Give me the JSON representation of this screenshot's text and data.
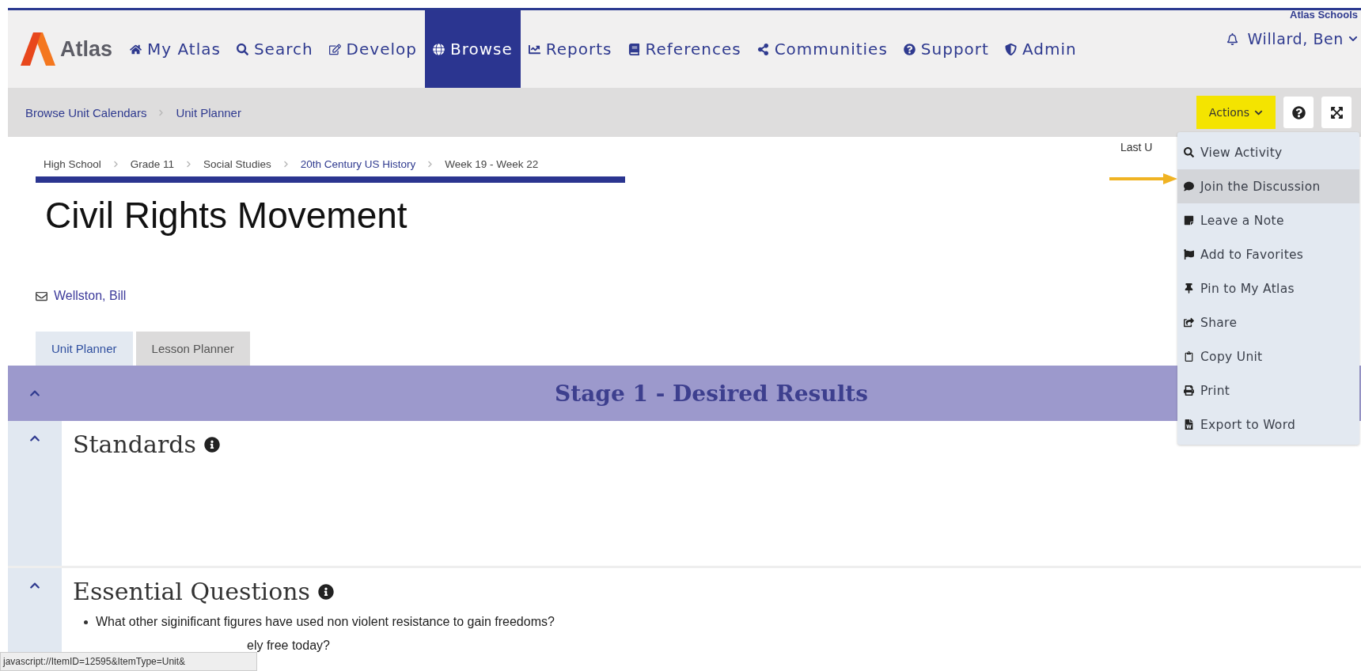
{
  "brand": {
    "name": "Atlas"
  },
  "nav": [
    {
      "label": "My Atlas",
      "selected": false
    },
    {
      "label": "Search",
      "selected": false
    },
    {
      "label": "Develop",
      "selected": false
    },
    {
      "label": "Browse",
      "selected": true
    },
    {
      "label": "Reports",
      "selected": false
    },
    {
      "label": "References",
      "selected": false
    },
    {
      "label": "Communities",
      "selected": false
    },
    {
      "label": "Support",
      "selected": false
    },
    {
      "label": "Admin",
      "selected": false
    }
  ],
  "account": {
    "school": "Atlas Schools",
    "user": "Willard, Ben"
  },
  "breadcrumb": [
    "Browse Unit Calendars",
    "Unit Planner"
  ],
  "actions": {
    "label": "Actions",
    "menu": [
      {
        "label": "View Activity",
        "highlighted": false
      },
      {
        "label": "Join the Discussion",
        "highlighted": true
      },
      {
        "label": "Leave a Note",
        "highlighted": false
      },
      {
        "label": "Add to Favorites",
        "highlighted": false
      },
      {
        "label": "Pin to My Atlas",
        "highlighted": false
      },
      {
        "label": "Share",
        "highlighted": false
      },
      {
        "label": "Copy Unit",
        "highlighted": false
      },
      {
        "label": "Print",
        "highlighted": false
      },
      {
        "label": "Export to Word",
        "highlighted": false
      }
    ]
  },
  "unit_path": [
    {
      "label": "High School",
      "link": false
    },
    {
      "label": "Grade 11",
      "link": false
    },
    {
      "label": "Social Studies",
      "link": false
    },
    {
      "label": "20th Century US History",
      "link": true
    },
    {
      "label": "Week 19 - Week 22",
      "link": false
    }
  ],
  "last_updated": "Last U",
  "title": "Civil Rights Movement",
  "author": "Wellston, Bill",
  "tabs": [
    {
      "label": "Unit Planner",
      "selected": true
    },
    {
      "label": "Lesson Planner",
      "selected": false
    }
  ],
  "stage": {
    "title": "Stage 1 - Desired Results",
    "expanded": true
  },
  "sections": [
    {
      "title": "Standards",
      "expanded": true
    },
    {
      "title": "Essential Questions",
      "expanded": true,
      "questions": [
        "What other siginificant figures have used non violent resistance to gain freedoms?",
        "ely free today?"
      ]
    }
  ],
  "status_url": "javascript://ItemID=12595&ItemType=Unit&"
}
